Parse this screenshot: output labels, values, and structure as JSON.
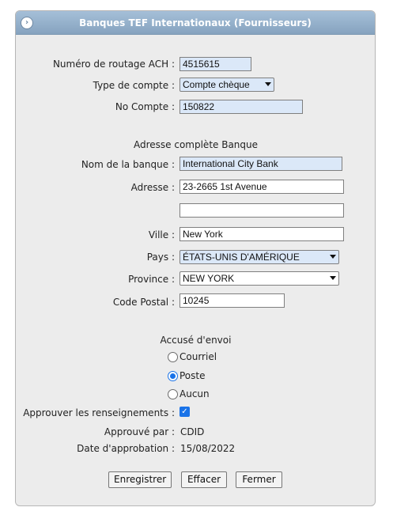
{
  "header": {
    "title": "Banques TEF Internationaux (Fournisseurs)",
    "icon": "chevron-right-circle-icon"
  },
  "form": {
    "routing_label": "Numéro de routage ACH :",
    "routing_value": "4515615",
    "account_type_label": "Type de compte :",
    "account_type_value": "Compte chèque",
    "account_number_label": "No Compte :",
    "account_number_value": "150822",
    "bank_address_heading": "Adresse complète Banque",
    "bank_name_label": "Nom de la banque :",
    "bank_name_value": "International City Bank",
    "address_label": "Adresse :",
    "address_line1": "23-2665 1st Avenue",
    "address_line2": "",
    "city_label": "Ville :",
    "city_value": "New York",
    "country_label": "Pays :",
    "country_value": "ÉTATS-UNIS D'AMÉRIQUE",
    "province_label": "Province :",
    "province_value": "NEW YORK",
    "postal_label": "Code Postal :",
    "postal_value": "10245"
  },
  "delivery": {
    "heading": "Accusé d'envoi",
    "options": [
      {
        "label": "Courriel",
        "selected": false
      },
      {
        "label": "Poste",
        "selected": true
      },
      {
        "label": "Aucun",
        "selected": false
      }
    ]
  },
  "approval": {
    "approve_label": "Approuver les renseignements :",
    "approve_checked": true,
    "approved_by_label": "Approuvé par :",
    "approved_by_value": "CDID",
    "approval_date_label": "Date d'approbation :",
    "approval_date_value": "15/08/2022"
  },
  "buttons": {
    "save": "Enregistrer",
    "clear": "Effacer",
    "close": "Fermer"
  },
  "colors": {
    "title_bar": "#93aec9",
    "field_highlight": "#dbe8f8",
    "accent": "#1a73e8"
  }
}
